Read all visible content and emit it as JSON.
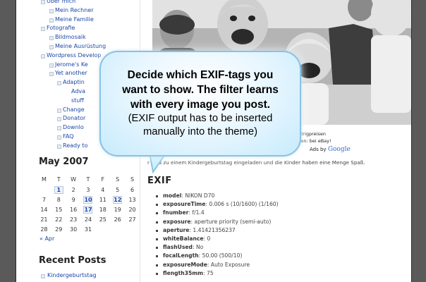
{
  "sidebar": {
    "nav_items": [
      {
        "label": "Über mich",
        "level": 0
      },
      {
        "label": "Mein Rechner",
        "level": 1
      },
      {
        "label": "Meine Familie",
        "level": 1
      },
      {
        "label": "Fotografie",
        "level": 0
      },
      {
        "label": "Bildmosaik",
        "level": 1
      },
      {
        "label": "Meine Ausrüstung",
        "level": 1
      },
      {
        "label": "Wordpress Develop",
        "level": 0
      },
      {
        "label": "Jerome's Ke",
        "level": 1
      },
      {
        "label": "Yet another",
        "level": 1
      },
      {
        "label": "Adaptin",
        "level": 2
      },
      {
        "label": "Adva",
        "level": 3
      },
      {
        "label": "stuff",
        "level": 3
      },
      {
        "label": "Change",
        "level": 2
      },
      {
        "label": "Donator",
        "level": 2
      },
      {
        "label": "Downlo",
        "level": 2
      },
      {
        "label": "FAQ",
        "level": 2
      },
      {
        "label": "Ready to",
        "level": 2
      }
    ],
    "calendar": {
      "title": "May 2007",
      "weekdays": [
        "M",
        "T",
        "W",
        "T",
        "F",
        "S",
        "S"
      ],
      "rows": [
        [
          "",
          "1",
          "2",
          "3",
          "4",
          "5",
          "6"
        ],
        [
          "7",
          "8",
          "9",
          "10",
          "11",
          "12",
          "13"
        ],
        [
          "14",
          "15",
          "16",
          "17",
          "18",
          "19",
          "20"
        ],
        [
          "21",
          "22",
          "23",
          "24",
          "25",
          "26",
          "27"
        ],
        [
          "28",
          "29",
          "30",
          "31",
          "",
          "",
          ""
        ]
      ],
      "linked_days": [
        "1",
        "10",
        "12",
        "17"
      ],
      "prev_link": "« Apr"
    },
    "recent_posts_title": "Recent Posts",
    "recent_posts": [
      "Kindergeburtstag"
    ]
  },
  "main": {
    "ad_line1": "zu Niedrigpreisen",
    "ad_line2": "Angeboten: bei eBay!",
    "ads_by": "Ads by",
    "ads_brand": "Google",
    "caption": "r sind zu einem Kindergeburtstag eingeladen und die Kinder haben eine Menge Spaß.",
    "exif_title": "EXIF",
    "exif": [
      {
        "key": "model",
        "value": "NIKON D70"
      },
      {
        "key": "exposureTime",
        "value": "0.006 s (10/1600) (1/160)"
      },
      {
        "key": "fnumber",
        "value": "f/1.4"
      },
      {
        "key": "exposure",
        "value": "aperture priority (semi-auto)"
      },
      {
        "key": "aperture",
        "value": "1.41421356237"
      },
      {
        "key": "whiteBalance",
        "value": "0"
      },
      {
        "key": "flashUsed",
        "value": "No"
      },
      {
        "key": "focalLength",
        "value": "50.00 (500/10)"
      },
      {
        "key": "exposureMode",
        "value": "Auto Exposure"
      },
      {
        "key": "flength35mm",
        "value": "75"
      }
    ]
  },
  "callout": {
    "line1": "Decide which EXIF-tags you",
    "line2": "want to show. The filter learns",
    "line3": "with every image you post.",
    "line4": "(EXIF output has to be inserted",
    "line5": "manually into the theme)"
  },
  "colors": {
    "link": "#1a47a6",
    "callout_border": "#89c3e2",
    "background": "#5a5a5a"
  }
}
